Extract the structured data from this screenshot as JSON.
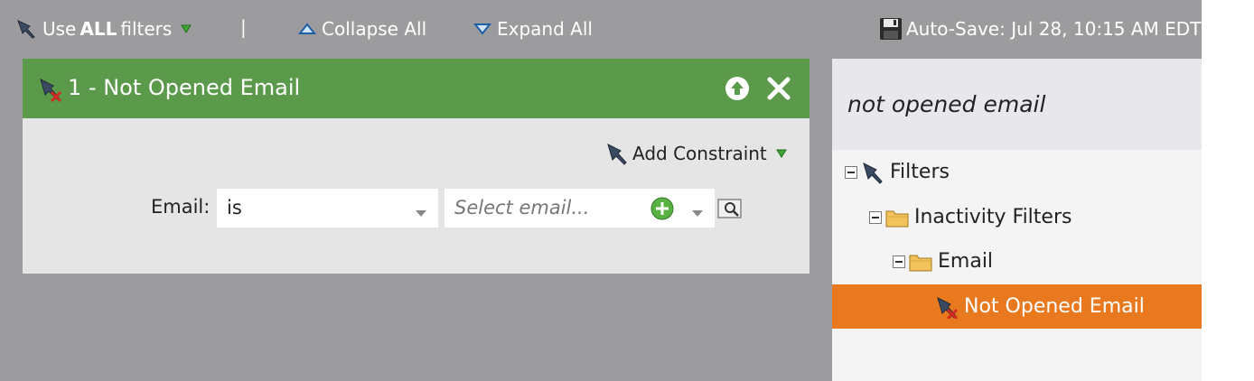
{
  "toolbar": {
    "use_prefix": "Use ",
    "use_bold": "ALL",
    "use_suffix": " filters",
    "separator": "|",
    "collapse_all": "Collapse All",
    "expand_all": "Expand All",
    "autosave": "Auto-Save: Jul 28, 10:15 AM EDT"
  },
  "filter": {
    "title": "1 - Not Opened Email",
    "add_constraint": "Add Constraint",
    "email_label": "Email:",
    "operator_value": "is",
    "email_placeholder": "Select email..."
  },
  "panel": {
    "search_query": "not opened email",
    "tree": [
      {
        "label": "Filters",
        "icon": "funnel-icon"
      },
      {
        "label": "Inactivity Filters",
        "icon": "folder-icon"
      },
      {
        "label": "Email",
        "icon": "folder-icon"
      },
      {
        "label": "Not Opened Email",
        "icon": "funnel-x-icon",
        "selected": true
      }
    ]
  },
  "colors": {
    "canvas_bg": "#9c9c9e",
    "header_green": "#5c9a4b",
    "selected_orange": "#e8791f",
    "panel_bg": "#f4f4f4"
  }
}
